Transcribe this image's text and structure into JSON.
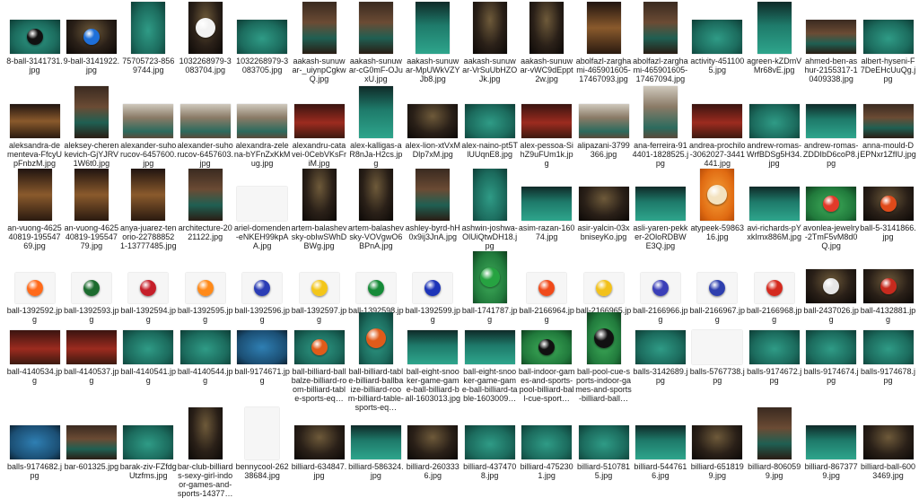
{
  "files": [
    {
      "name": "8-ball-3141731.jpg",
      "look": "felt",
      "ball": "#111111"
    },
    {
      "name": "9-ball-3141922.jpg",
      "look": "dark",
      "ball": "#1e6fd9"
    },
    {
      "name": "75705723-8569744.jpg",
      "look": "felt"
    },
    {
      "name": "1032268979-3083704.jpg",
      "look": "dark",
      "ball": "#f2f2f2"
    },
    {
      "name": "1032268979-3083705.jpg",
      "look": "felt"
    },
    {
      "name": "aakash-sunuwar-_uiynpCgkwQ.jpg",
      "look": "room"
    },
    {
      "name": "aakash-sunuwar-cG0mF-OJuxU.jpg",
      "look": "room"
    },
    {
      "name": "aakash-sunuwar-MpUWkVZYJb8.jpg",
      "look": "felt2"
    },
    {
      "name": "aakash-sunuwar-VrSuUbHZOJk.jpg",
      "look": "dark"
    },
    {
      "name": "aakash-sunuwar-vWC9dEppt2w.jpg",
      "look": "dark"
    },
    {
      "name": "abolfazl-zarghami-465901605-17467093.jpg",
      "look": "warm"
    },
    {
      "name": "abolfazl-zarghami-465901605-17467094.jpg",
      "look": "room"
    },
    {
      "name": "activity-4511005.jpg",
      "look": "felt"
    },
    {
      "name": "agreen-kZDmVMr68vE.jpg",
      "look": "felt2"
    },
    {
      "name": "ahmed-ben-ashur-2155317-10409338.jpg",
      "look": "room"
    },
    {
      "name": "albert-hyseni-F7DeEHcUuQg.jpg",
      "look": "felt"
    },
    {
      "name": "aleksandra-dementeva-FfcyUpFnbzM.jpg",
      "look": "warm"
    },
    {
      "name": "aleksey-cherenkevich-GjYJRV1W6t0.jpg",
      "look": "room"
    },
    {
      "name": "alexander-suhorucov-6457600.jpg",
      "look": "people"
    },
    {
      "name": "alexander-suhorucov-6457603.jpg",
      "look": "people"
    },
    {
      "name": "alexandra-zelena-bYFnZxKkMug.jpg",
      "look": "people"
    },
    {
      "name": "alexandru-catavei-0CebVKsFriM.jpg",
      "look": "red"
    },
    {
      "name": "alex-kalligas-aR8nJa-H2cs.jpg",
      "look": "felt2"
    },
    {
      "name": "alex-lion-xtVxMDlp7xM.jpg",
      "look": "dark"
    },
    {
      "name": "alex-naino-pt5TlUUqnE8.jpg",
      "look": "felt"
    },
    {
      "name": "alex-pessoa-SihZ9uFUm1k.jpg",
      "look": "red"
    },
    {
      "name": "alipazani-3799366.jpg",
      "look": "people"
    },
    {
      "name": "ana-ferreira-914401-1828525.jpg",
      "look": "people"
    },
    {
      "name": "andrea-prochilo-3062027-3441441.jpg",
      "look": "red"
    },
    {
      "name": "andrew-romas-WrfBDSg5H34.jpg",
      "look": "felt"
    },
    {
      "name": "andrew-romas-ZDDIbD6coP8.jpg",
      "look": "felt2"
    },
    {
      "name": "anna-mould-DEPNxr1ZfIU.jpg",
      "look": "room"
    },
    {
      "name": "an-vuong-462540819-19554769.jpg",
      "look": "warm"
    },
    {
      "name": "an-vuong-462540819-19554779.jpg",
      "look": "warm"
    },
    {
      "name": "anya-juarez-tenorio-227888521-13777485.jpg",
      "look": "warm"
    },
    {
      "name": "architecture-2021122.jpg",
      "look": "room"
    },
    {
      "name": "ariel-domenden-eNKEH99kpAA.jpg",
      "look": "white"
    },
    {
      "name": "artem-balashevsky-obIwSWhDBWg.jpg",
      "look": "dark"
    },
    {
      "name": "artem-balashevsky-VOVgwO6BPnA.jpg",
      "look": "dark"
    },
    {
      "name": "ashley-byrd-hH0x9ij3JnA.jpg",
      "look": "room"
    },
    {
      "name": "ashwin-joshwa-OlUiQtwDH18.jpg",
      "look": "felt"
    },
    {
      "name": "asim-razan-16074.jpg",
      "look": "felt2"
    },
    {
      "name": "asir-yalcin-03xbniseyKo.jpg",
      "look": "dark"
    },
    {
      "name": "asli-yaren-pekker-2OloRDBWE3Q.jpg",
      "look": "felt2"
    },
    {
      "name": "atypeek-5986316.jpg",
      "look": "orange",
      "ball": "#f3e2c0"
    },
    {
      "name": "avi-richards-pYxkImx886M.jpg",
      "look": "felt2"
    },
    {
      "name": "avonlea-jewelry-2TmF5vM8d0Q.jpg",
      "look": "green",
      "ball": "#e23a2a"
    },
    {
      "name": "ball-5-3141866.jpg",
      "look": "dark",
      "ball": "#e04a1a"
    },
    {
      "name": "ball-1392592.jpg",
      "look": "white",
      "ball": "#ff6a1a"
    },
    {
      "name": "ball-1392593.jpg",
      "look": "white",
      "ball": "#1c6b2e"
    },
    {
      "name": "ball-1392594.jpg",
      "look": "white",
      "ball": "#c51f2a"
    },
    {
      "name": "ball-1392595.jpg",
      "look": "white",
      "ball": "#ff8a1a"
    },
    {
      "name": "ball-1392596.jpg",
      "look": "white",
      "ball": "#2b3db5"
    },
    {
      "name": "ball-1392597.jpg",
      "look": "white",
      "ball": "#f3c61a"
    },
    {
      "name": "ball-1392598.jpg",
      "look": "white",
      "ball": "#168a38"
    },
    {
      "name": "ball-1392599.jpg",
      "look": "white",
      "ball": "#1d34b8"
    },
    {
      "name": "ball-1741787.jpg",
      "look": "green",
      "ball": "#26a341"
    },
    {
      "name": "ball-2166964.jpg",
      "look": "white",
      "ball": "#f04a1a"
    },
    {
      "name": "ball-2166965.jpg",
      "look": "white",
      "ball": "#f2c11b"
    },
    {
      "name": "ball-2166966.jpg",
      "look": "white",
      "ball": "#3b3fb8"
    },
    {
      "name": "ball-2166967.jpg",
      "look": "white",
      "ball": "#2e3fae"
    },
    {
      "name": "ball-2166968.jpg",
      "look": "white",
      "ball": "#d42a1f"
    },
    {
      "name": "ball-2437026.jpg",
      "look": "dark",
      "ball": "#e6e6e6"
    },
    {
      "name": "ball-4132881.jpg",
      "look": "dark",
      "ball": "#c72a1e"
    },
    {
      "name": "ball-4140534.jpg",
      "look": "red"
    },
    {
      "name": "ball-4140537.jpg",
      "look": "red"
    },
    {
      "name": "ball-4140541.jpg",
      "look": "felt"
    },
    {
      "name": "ball-4140544.jpg",
      "look": "felt"
    },
    {
      "name": "ball-9174671.jpg",
      "look": "blue"
    },
    {
      "name": "ball-billiard-ballbalze-billiard-room-billiard-table-sports-eq…",
      "look": "felt",
      "ball": "#e05b1a"
    },
    {
      "name": "ball-billiard-table-billiard-ballbaize-billiard-room-billiard-table-sports-eq…",
      "look": "felt",
      "ball": "#e05b1a"
    },
    {
      "name": "ball-eight-snooker-game-game-ball-billiard-ball-1603013.jpg",
      "look": "felt2"
    },
    {
      "name": "ball-eight-snooker-game-game-ball-billiard-table-1603009…",
      "look": "felt2"
    },
    {
      "name": "ball-indoor-games-and-sports-pool-billiard-ball-cue-sport…",
      "look": "green",
      "ball": "#111111"
    },
    {
      "name": "ball-pool-cue-sports-indoor-games-and-sports-billiard-ball…",
      "look": "green",
      "ball": "#111111"
    },
    {
      "name": "balls-3142689.jpg",
      "look": "felt"
    },
    {
      "name": "balls-5767738.jpg",
      "look": "white"
    },
    {
      "name": "balls-9174672.jpg",
      "look": "felt"
    },
    {
      "name": "balls-9174674.jpg",
      "look": "felt"
    },
    {
      "name": "balls-9174678.jpg",
      "look": "felt"
    },
    {
      "name": "balls-9174682.jpg",
      "look": "blue"
    },
    {
      "name": "bar-601325.jpg",
      "look": "room"
    },
    {
      "name": "barak-ziv-FZfdgUtzfms.jpg",
      "look": "felt"
    },
    {
      "name": "bar-club-billiards-sexy-girl-indoor-games-and-sports-14377…",
      "look": "dark"
    },
    {
      "name": "bennycool-26238684.jpg",
      "look": "white"
    },
    {
      "name": "billiard-634847.jpg",
      "look": "dark"
    },
    {
      "name": "billiard-586324.jpg",
      "look": "felt2"
    },
    {
      "name": "billiard-2603336.jpg",
      "look": "dark"
    },
    {
      "name": "billiard-4374708.jpg",
      "look": "felt"
    },
    {
      "name": "billiard-4752301.jpg",
      "look": "felt"
    },
    {
      "name": "billiard-5107815.jpg",
      "look": "felt"
    },
    {
      "name": "billiard-5447616.jpg",
      "look": "felt2"
    },
    {
      "name": "billiard-6518199.jpg",
      "look": "dark"
    },
    {
      "name": "billiard-8060599.jpg",
      "look": "room"
    },
    {
      "name": "billiard-8673779.jpg",
      "look": "felt2"
    },
    {
      "name": "billiard-ball-6003469.jpg",
      "look": "dark"
    }
  ]
}
